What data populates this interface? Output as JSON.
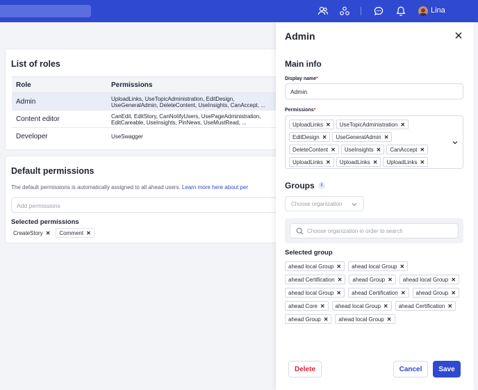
{
  "header": {
    "user_name": "Lina",
    "icons": [
      "users-icon",
      "groups-icon",
      "chat-icon",
      "bell-icon"
    ]
  },
  "roles": {
    "title": "List of roles",
    "col_role": "Role",
    "col_permissions": "Permissions",
    "rows": [
      {
        "role": "Admin",
        "perm1": "UploadLinks, UseTopicAdministration, EditDesign,",
        "perm2": "UseGeneralAdmin, DeleteContent, UseInsights, CanAccept, ..."
      },
      {
        "role": "Content editor",
        "perm1": "CanEdit, EditStory, CanNotifyUsers, UsePageAdministration,",
        "perm2": "EditCareable, UseInsights, PinNews, UseMustRead, ..."
      },
      {
        "role": "Developer",
        "perm1": "UseSwagger",
        "perm2": ""
      }
    ]
  },
  "defaults": {
    "title": "Default permissions",
    "description": "The default permissions is automatically assigned to all ahead users.",
    "learn_more": "Learn more here about per",
    "add_placeholder": "Add permissions",
    "selected_title": "Selected permissions",
    "selected": [
      "CreateStory",
      "Comment"
    ]
  },
  "drawer": {
    "title": "Admin",
    "main_info": "Main info",
    "display_name_label": "Display name",
    "display_name_value": "Admin",
    "permissions_label": "Permissions",
    "permissions": [
      "UploadLinks",
      "UseTopicAdministration",
      "EditDesign",
      "UseGeneralAdmin",
      "DeleteContent",
      "UseInsights",
      "CanAccept",
      "UploadLinks",
      "UploadLinks",
      "UploadLinks"
    ],
    "groups_title": "Groups",
    "choose_org": "Choose organization",
    "search_placeholder": "Choose organization in order to search",
    "selected_group_title": "Selected group",
    "groups": [
      "ahead local Group",
      "ahead local Group",
      "ahead Certification",
      "ahead Group",
      "ahead local Group",
      "ahead local Group",
      "ahead Certification",
      "ahead Group",
      "ahead Core",
      "ahead local Group",
      "ahead Certification",
      "ahead Group",
      "ahead local Group"
    ],
    "delete_label": "Delete",
    "cancel_label": "Cancel",
    "save_label": "Save"
  },
  "colors": {
    "brand": "#2f49d1",
    "danger": "#d8263b",
    "info": "#5a6ee0"
  }
}
